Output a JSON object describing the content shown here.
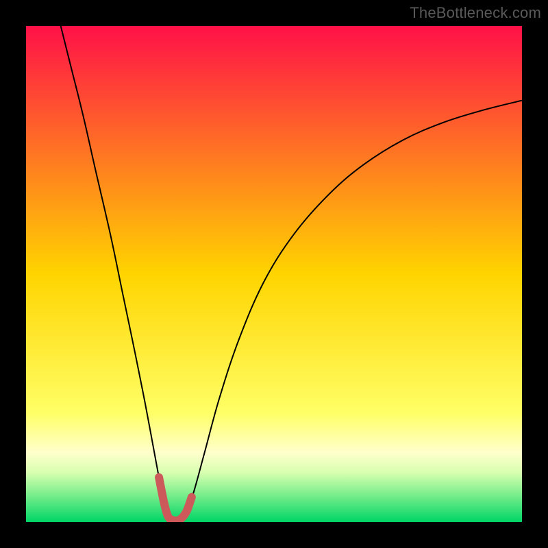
{
  "watermark": "TheBottleneck.com",
  "chart_data": {
    "type": "line",
    "title": "",
    "xlabel": "",
    "ylabel": "",
    "xlim": [
      0,
      100
    ],
    "ylim": [
      0,
      100
    ],
    "grid": false,
    "legend": false,
    "gradient_stops": [
      {
        "pos": 0.0,
        "color": "#ff1148"
      },
      {
        "pos": 0.5,
        "color": "#ffd400"
      },
      {
        "pos": 0.78,
        "color": "#ffff66"
      },
      {
        "pos": 0.86,
        "color": "#ffffcc"
      },
      {
        "pos": 0.9,
        "color": "#d8ffb0"
      },
      {
        "pos": 0.94,
        "color": "#85f090"
      },
      {
        "pos": 1.0,
        "color": "#00d566"
      }
    ],
    "series": [
      {
        "name": "main-curve",
        "stroke": "#000000",
        "stroke_width": 2,
        "points": [
          {
            "x": 7.0,
            "y": 100.0
          },
          {
            "x": 9.0,
            "y": 92.0
          },
          {
            "x": 11.5,
            "y": 82.0
          },
          {
            "x": 14.0,
            "y": 71.0
          },
          {
            "x": 17.0,
            "y": 58.0
          },
          {
            "x": 19.5,
            "y": 46.0
          },
          {
            "x": 22.0,
            "y": 34.0
          },
          {
            "x": 24.0,
            "y": 24.0
          },
          {
            "x": 25.5,
            "y": 16.0
          },
          {
            "x": 26.8,
            "y": 9.0
          },
          {
            "x": 27.8,
            "y": 4.0
          },
          {
            "x": 28.6,
            "y": 1.2
          },
          {
            "x": 29.5,
            "y": 0.4
          },
          {
            "x": 30.5,
            "y": 0.3
          },
          {
            "x": 31.4,
            "y": 0.8
          },
          {
            "x": 32.4,
            "y": 2.2
          },
          {
            "x": 33.8,
            "y": 6.0
          },
          {
            "x": 36.0,
            "y": 14.0
          },
          {
            "x": 39.0,
            "y": 25.0
          },
          {
            "x": 43.0,
            "y": 37.0
          },
          {
            "x": 48.0,
            "y": 48.5
          },
          {
            "x": 54.0,
            "y": 58.0
          },
          {
            "x": 61.0,
            "y": 66.0
          },
          {
            "x": 68.0,
            "y": 72.0
          },
          {
            "x": 76.0,
            "y": 77.0
          },
          {
            "x": 84.0,
            "y": 80.5
          },
          {
            "x": 92.0,
            "y": 83.0
          },
          {
            "x": 100.0,
            "y": 85.0
          }
        ]
      },
      {
        "name": "highlight-near-minimum",
        "stroke": "#cc5a5a",
        "stroke_width": 12,
        "linecap": "round",
        "points": [
          {
            "x": 26.8,
            "y": 9.0
          },
          {
            "x": 27.8,
            "y": 4.0
          },
          {
            "x": 28.6,
            "y": 1.2
          },
          {
            "x": 29.5,
            "y": 0.4
          },
          {
            "x": 30.5,
            "y": 0.3
          },
          {
            "x": 31.4,
            "y": 0.8
          },
          {
            "x": 32.4,
            "y": 2.2
          },
          {
            "x": 33.4,
            "y": 5.0
          }
        ]
      }
    ]
  }
}
